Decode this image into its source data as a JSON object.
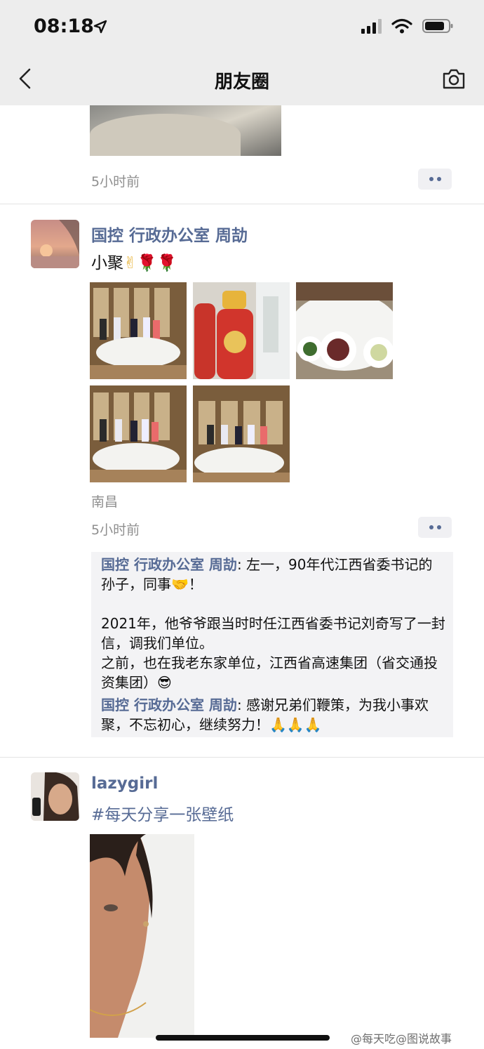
{
  "status_bar": {
    "time": "08:18",
    "icons": [
      "location-arrow-icon",
      "signal-icon",
      "wifi-icon",
      "battery-icon"
    ]
  },
  "nav": {
    "title": "朋友圈",
    "back_icon": "chevron-left-icon",
    "camera_icon": "camera-icon"
  },
  "posts": [
    {
      "time": "5小时前",
      "photo": "partial-photo"
    },
    {
      "author": "国控 行政办公室 周劼",
      "text": "小聚",
      "emojis": [
        "✌",
        "🌹",
        "🌹"
      ],
      "photos": [
        "group-photo-dinner-1",
        "liquor-bottles-photo",
        "dishes-photo",
        "group-photo-dinner-2",
        "group-photo-dinner-3"
      ],
      "location": "南昌",
      "time": "5小时前",
      "comments": [
        {
          "author": "国控 行政办公室 周劼",
          "sep": ": ",
          "text": "左一，90年代江西省委书记的孙子，同事🤝！\n\n2021年，他爷爷跟当时时任江西省委书记刘奇写了一封信，调我们单位。\n之前，也在我老东家单位，江西省高速集团（省交通投资集团）😎"
        },
        {
          "author": "国控 行政办公室 周劼",
          "sep": ": ",
          "text": "感谢兄弟们鞭策，为我小事欢聚，不忘初心，继续努力！🙏🙏🙏"
        }
      ]
    },
    {
      "author": "lazygirl",
      "text": "#每天分享一张壁纸",
      "photo": "portrait-wallpaper-photo"
    }
  ],
  "watermark": "@每天吃@图说故事",
  "colors": {
    "link": "#576b95",
    "nav_bg": "#ededed",
    "comment_bg": "#f3f3f5",
    "meta": "#8f8f8f"
  }
}
